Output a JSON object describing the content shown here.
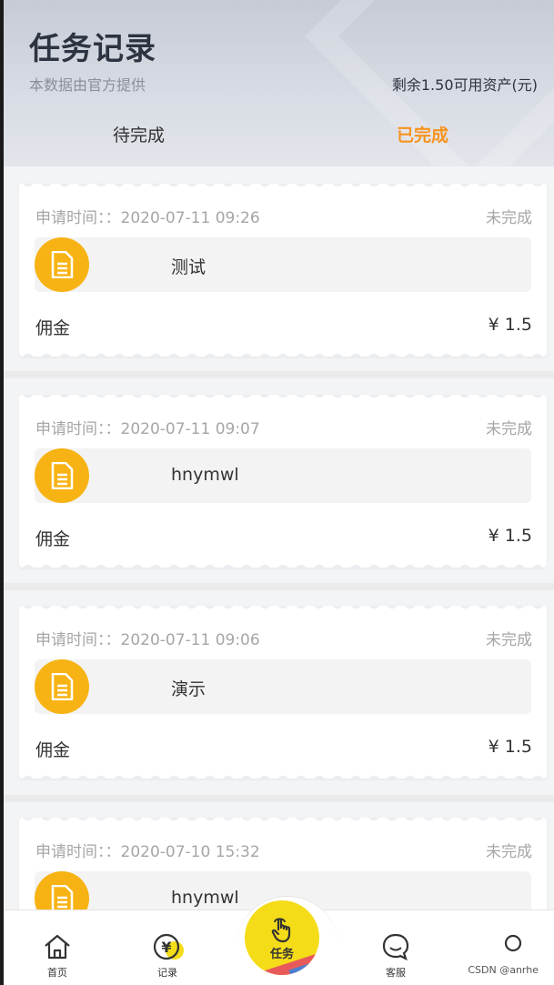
{
  "header": {
    "title": "任务记录",
    "subtitle": "本数据由官方提供",
    "balance": "剩余1.50可用资产(元)",
    "tabs": [
      {
        "label": "待完成"
      },
      {
        "label": "已完成"
      }
    ]
  },
  "records": [
    {
      "time": "申请时间：：2020-07-11 09:26",
      "status": "未完成",
      "name": "测试",
      "commission_label": "佣金",
      "commission_value": "¥ 1.5"
    },
    {
      "time": "申请时间：：2020-07-11 09:07",
      "status": "未完成",
      "name": "hnymwl",
      "commission_label": "佣金",
      "commission_value": "¥ 1.5"
    },
    {
      "time": "申请时间：：2020-07-11 09:06",
      "status": "未完成",
      "name": "演示",
      "commission_label": "佣金",
      "commission_value": "¥ 1.5"
    },
    {
      "time": "申请时间：：2020-07-10 15:32",
      "status": "未完成",
      "name": "hnymwl"
    }
  ],
  "tabbar": {
    "home": "首页",
    "record": "记录",
    "task": "任务",
    "service": "客服"
  },
  "watermark": "CSDN @anrhe",
  "colors": {
    "accent": "#f7931e",
    "icon_bg": "#f7b314",
    "task_button": "#f5dc19"
  }
}
